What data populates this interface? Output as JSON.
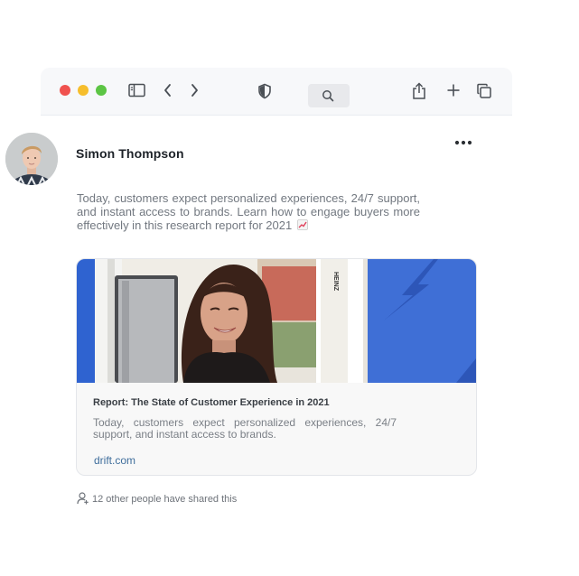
{
  "browser": {
    "window_controls": [
      "close",
      "minimize",
      "zoom"
    ],
    "icons": {
      "sidebar": "sidebar-toggle-icon",
      "back": "chevron-left-icon",
      "forward": "chevron-right-icon",
      "shield": "shield-icon",
      "search": "search-icon",
      "share": "share-icon",
      "new_tab": "plus-icon",
      "tabs": "tabs-overview-icon"
    }
  },
  "post": {
    "author": "Simon Thompson",
    "text": "Today, customers expect personalized experiences, 24/7 support, and instant access to brands. Learn how to engage buyers more effectively in this research report for 2021",
    "emoji": "chart-increasing-icon",
    "more_icon": "more-horizontal-icon"
  },
  "card": {
    "title": "Report: The State of Customer Experience in 2021",
    "description": "Today, customers expect personalized experiences, 24/7 support, and instant access to brands.",
    "domain": "drift.com",
    "image_sign_text": "HEINZ"
  },
  "footer": {
    "share_text": "12 other people have shared this",
    "share_icon": "person-share-icon"
  },
  "colors": {
    "accent_blue": "#3f6fd6",
    "link": "#3f6e9c",
    "close": "#f0524f",
    "minimize": "#f6be2c",
    "zoom": "#5cc544"
  }
}
